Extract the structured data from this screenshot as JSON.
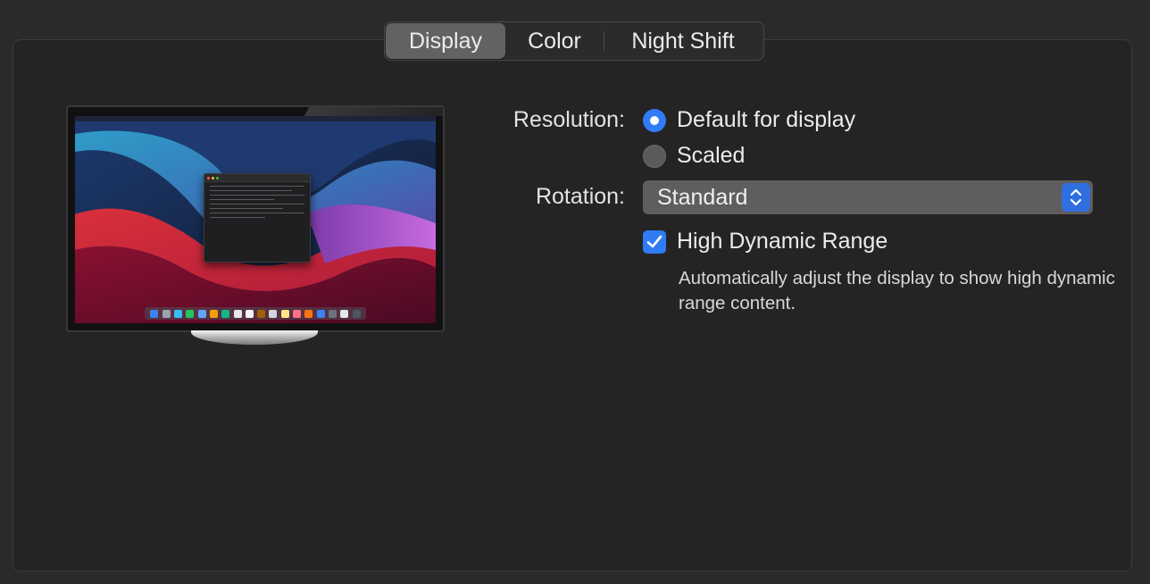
{
  "tabs": [
    {
      "label": "Display",
      "active": true
    },
    {
      "label": "Color",
      "active": false
    },
    {
      "label": "Night Shift",
      "active": false
    }
  ],
  "resolution": {
    "label": "Resolution:",
    "options": [
      {
        "label": "Default for display",
        "selected": true
      },
      {
        "label": "Scaled",
        "selected": false
      }
    ]
  },
  "rotation": {
    "label": "Rotation:",
    "value": "Standard"
  },
  "hdr": {
    "label": "High Dynamic Range",
    "checked": true,
    "description": "Automatically adjust the display to show high dynamic range content."
  },
  "colors": {
    "accent": "#2f7cf6",
    "panel_bg": "#252323",
    "active_tab": "#636161"
  },
  "icons": {
    "radio_on": "radio-selected-icon",
    "radio_off": "radio-unselected-icon",
    "checkbox": "checkmark-icon",
    "select": "chevron-up-down-icon"
  }
}
